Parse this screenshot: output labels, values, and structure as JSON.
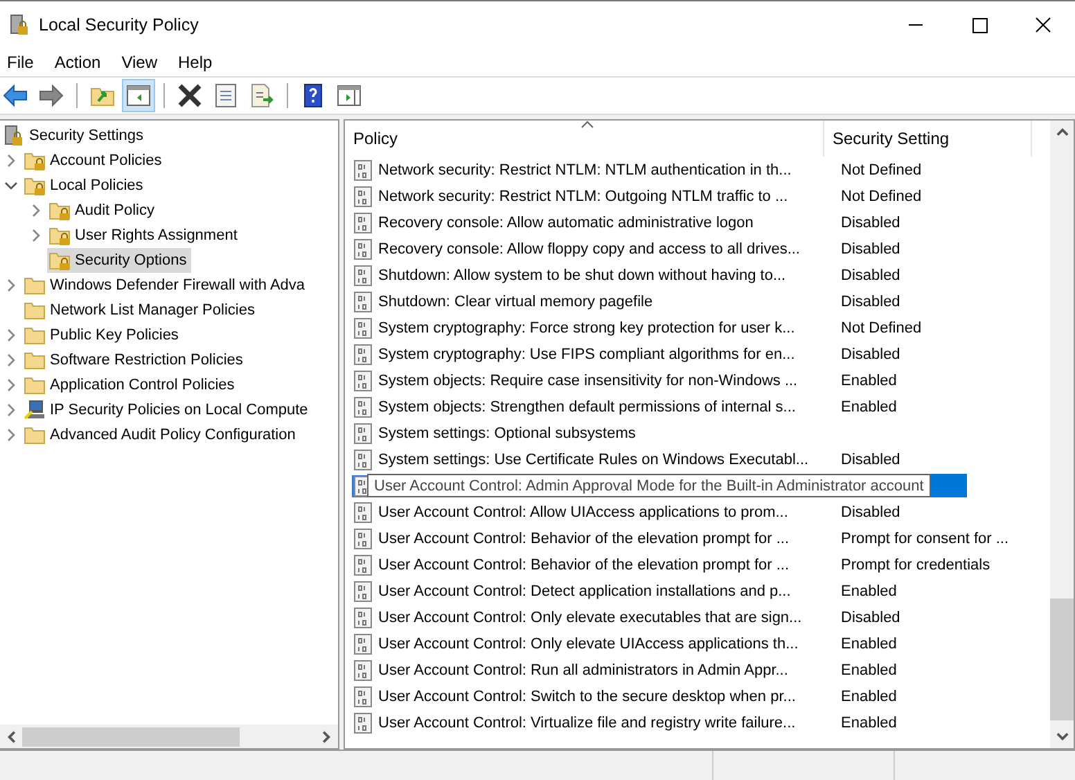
{
  "window": {
    "title": "Local Security Policy"
  },
  "menu": [
    "File",
    "Action",
    "View",
    "Help"
  ],
  "toolbar": [
    {
      "kind": "back",
      "selected": false
    },
    {
      "kind": "forward",
      "selected": false
    },
    {
      "kind": "up",
      "selected": false
    },
    {
      "kind": "tree",
      "selected": true
    },
    {
      "kind": "delete",
      "selected": false
    },
    {
      "kind": "properties",
      "selected": false
    },
    {
      "kind": "export",
      "selected": false
    },
    {
      "kind": "help",
      "selected": false
    },
    {
      "kind": "pane",
      "selected": false
    }
  ],
  "tree": {
    "label": "Security Settings",
    "children": [
      {
        "label": "Account Policies",
        "expanded": false,
        "kind": "locked",
        "selected": false
      },
      {
        "label": "Local Policies",
        "expanded": true,
        "kind": "locked",
        "selected": false,
        "children": [
          {
            "label": "Audit Policy",
            "expanded": false,
            "kind": "locked",
            "selected": false
          },
          {
            "label": "User Rights Assignment",
            "expanded": false,
            "kind": "locked",
            "selected": false
          },
          {
            "label": "Security Options",
            "kind": "locked",
            "selected": true
          }
        ]
      },
      {
        "label": "Windows Defender Firewall with Adva",
        "expanded": false,
        "kind": "folder",
        "selected": false
      },
      {
        "label": "Network List Manager Policies",
        "kind": "folder",
        "selected": false
      },
      {
        "label": "Public Key Policies",
        "expanded": false,
        "kind": "folder",
        "selected": false
      },
      {
        "label": "Software Restriction Policies",
        "expanded": false,
        "kind": "folder",
        "selected": false
      },
      {
        "label": "Application Control Policies",
        "expanded": false,
        "kind": "folder",
        "selected": false
      },
      {
        "label": "IP Security Policies on Local Compute",
        "expanded": false,
        "kind": "computer",
        "selected": false
      },
      {
        "label": "Advanced Audit Policy Configuration",
        "expanded": false,
        "kind": "folder",
        "selected": false
      }
    ]
  },
  "table": {
    "columns": [
      "Policy",
      "Security Setting"
    ],
    "rows": [
      {
        "policy": "Network security: Restrict NTLM: NTLM authentication in th...",
        "setting": "Not Defined",
        "selected": false
      },
      {
        "policy": "Network security: Restrict NTLM: Outgoing NTLM traffic to ...",
        "setting": "Not Defined",
        "selected": false
      },
      {
        "policy": "Recovery console: Allow automatic administrative logon",
        "setting": "Disabled",
        "selected": false
      },
      {
        "policy": "Recovery console: Allow floppy copy and access to all drives...",
        "setting": "Disabled",
        "selected": false
      },
      {
        "policy": "Shutdown: Allow system to be shut down without having to...",
        "setting": "Disabled",
        "selected": false
      },
      {
        "policy": "Shutdown: Clear virtual memory pagefile",
        "setting": "Disabled",
        "selected": false
      },
      {
        "policy": "System cryptography: Force strong key protection for user k...",
        "setting": "Not Defined",
        "selected": false
      },
      {
        "policy": "System cryptography: Use FIPS compliant algorithms for en...",
        "setting": "Disabled",
        "selected": false
      },
      {
        "policy": "System objects: Require case insensitivity for non-Windows ...",
        "setting": "Enabled",
        "selected": false
      },
      {
        "policy": "System objects: Strengthen default permissions of internal s...",
        "setting": "Enabled",
        "selected": false
      },
      {
        "policy": "System settings: Optional subsystems",
        "selected": false
      },
      {
        "policy": "System settings: Use Certificate Rules on Windows Executabl...",
        "setting": "Disabled",
        "selected": false
      },
      {
        "policy": "User Account Control: Admin Approval Mode for the Built-in Administrator account",
        "selected": true
      },
      {
        "policy": "User Account Control: Allow UIAccess applications to prom...",
        "setting": "Disabled",
        "selected": false
      },
      {
        "policy": "User Account Control: Behavior of the elevation prompt for ...",
        "setting": "Prompt for consent for ...",
        "selected": false
      },
      {
        "policy": "User Account Control: Behavior of the elevation prompt for ...",
        "setting": "Prompt for credentials",
        "selected": false
      },
      {
        "policy": "User Account Control: Detect application installations and p...",
        "setting": "Enabled",
        "selected": false
      },
      {
        "policy": "User Account Control: Only elevate executables that are sign...",
        "setting": "Disabled",
        "selected": false
      },
      {
        "policy": "User Account Control: Only elevate UIAccess applications th...",
        "setting": "Enabled",
        "selected": false
      },
      {
        "policy": "User Account Control: Run all administrators in Admin Appr...",
        "setting": "Enabled",
        "selected": false
      },
      {
        "policy": "User Account Control: Switch to the secure desktop when pr...",
        "setting": "Enabled",
        "selected": false
      },
      {
        "policy": "User Account Control: Virtualize file and registry write failure...",
        "setting": "Enabled",
        "selected": false
      }
    ]
  }
}
